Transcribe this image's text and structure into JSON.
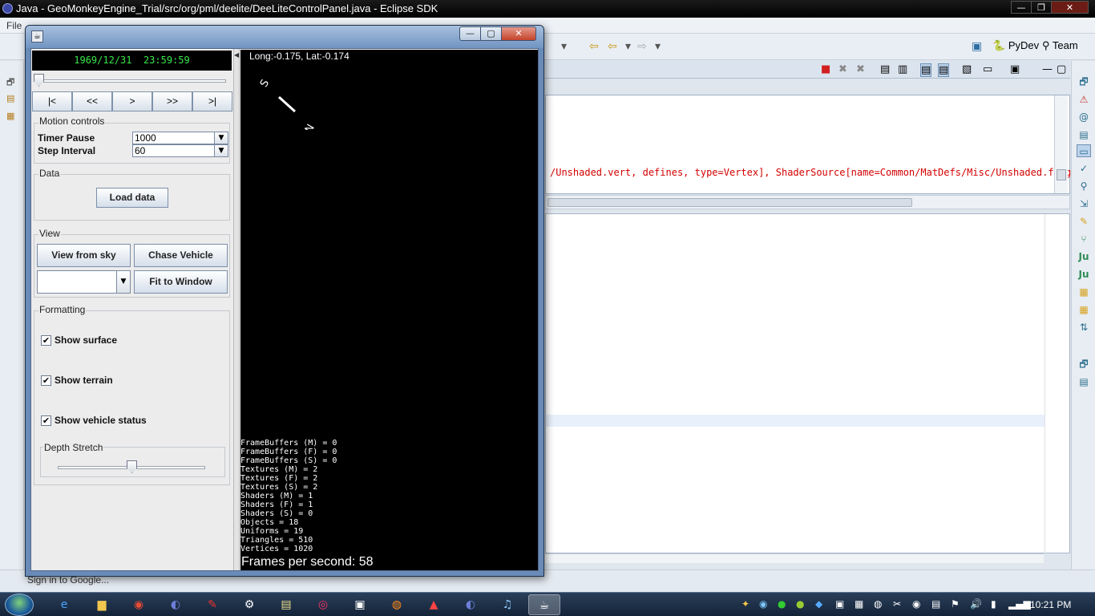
{
  "eclipse": {
    "title": "Java - GeoMonkeyEngine_Trial/src/org/pml/deelite/DeeLiteControlPanel.java - Eclipse SDK",
    "menu_file": "File",
    "perspectives": {
      "pydev": "PyDev",
      "team": "Team"
    },
    "console_line": "/Unshaded.vert, defines, type=Vertex], ShaderSource[name=Common/MatDefs/Misc/Unshaded.frag,",
    "status_text": "Sign in to Google..."
  },
  "dl_window": {
    "clock": "1969/12/31  23:59:59",
    "time_slider_value": 0,
    "nav": {
      "first": "|<",
      "rewind": "<<",
      "play": ">",
      "forward": ">>",
      "last": ">|"
    },
    "motion": {
      "title": "Motion controls",
      "timer_pause_label": "Timer Pause",
      "timer_pause_value": "1000",
      "step_interval_label": "Step Interval",
      "step_interval_value": "60"
    },
    "data_group": {
      "title": "Data",
      "load_button": "Load data"
    },
    "view_group": {
      "title": "View",
      "view_from_sky": "View from sky",
      "chase_vehicle": "Chase Vehicle",
      "view_select_value": "",
      "fit_to_window": "Fit to Window"
    },
    "formatting": {
      "title": "Formatting",
      "show_surface": "Show surface",
      "show_surface_checked": true,
      "show_terrain": "Show terrain",
      "show_terrain_checked": true,
      "show_vehicle_status": "Show vehicle status",
      "show_vehicle_status_checked": true,
      "depth_stretch": "Depth Stretch",
      "depth_stretch_value": 0.5
    },
    "view3d": {
      "coords": "Long:-0.175, Lat:-0.174",
      "compass_s": "S",
      "compass_n": "N",
      "stats": [
        "FrameBuffers (M) = 0",
        "FrameBuffers (F) = 0",
        "FrameBuffers (S) = 0",
        "Textures (M) = 2",
        "Textures (F) = 2",
        "Textures (S) = 2",
        "Shaders (M) = 1",
        "Shaders (F) = 1",
        "Shaders (S) = 0",
        "Objects = 18",
        "Uniforms = 19",
        "Triangles = 510",
        "Vertices = 1020"
      ],
      "fps": "Frames per second: 58"
    }
  },
  "taskbar": {
    "clock": "10:21 PM"
  },
  "colors": {
    "clock_green": "#37e74a",
    "console_red": "#d40000"
  }
}
